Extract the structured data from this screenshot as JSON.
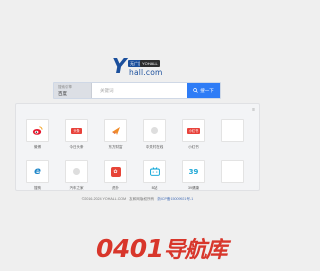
{
  "logo": {
    "letter": "Y",
    "tag_main": "无广告",
    "tag_sub": "YOHALL",
    "domain": "hall.com"
  },
  "search": {
    "engine_caption": "搜索引擎",
    "engine_name": "百度",
    "placeholder": "关键词",
    "button_label": "搜一下"
  },
  "panel": {
    "tool_icon": "≡"
  },
  "sites": [
    {
      "label": "微博",
      "icon": "weibo-icon"
    },
    {
      "label": "今日头条",
      "icon": "toutiao-icon",
      "badge": "头条"
    },
    {
      "label": "东方财富",
      "icon": "eastmoney-icon"
    },
    {
      "label": "中关村在线",
      "icon": "zol-icon"
    },
    {
      "label": "小红书",
      "icon": "xiaohongshu-icon",
      "badge": "小红书"
    },
    {
      "label": "",
      "icon": "blank-icon"
    },
    {
      "label": "搜狗",
      "icon": "sogou-icon"
    },
    {
      "label": "汽车之家",
      "icon": "autohome-icon"
    },
    {
      "label": "虎扑",
      "icon": "hupu-icon"
    },
    {
      "label": "B站",
      "icon": "bilibili-icon"
    },
    {
      "label": "39健康",
      "icon": "39health-icon"
    },
    {
      "label": "",
      "icon": "blank-icon"
    }
  ],
  "footer": {
    "copyright": "©2016-2024 YOHALL.COM",
    "disclaimer": "友和网版权所有",
    "beian": "浙ICP备15009921号-1"
  },
  "watermark": {
    "number": "0401",
    "text": "导航库"
  },
  "colors": {
    "brand": "#1b4f9c",
    "search_button": "#2e7cf6",
    "watermark": "#d8362b"
  }
}
